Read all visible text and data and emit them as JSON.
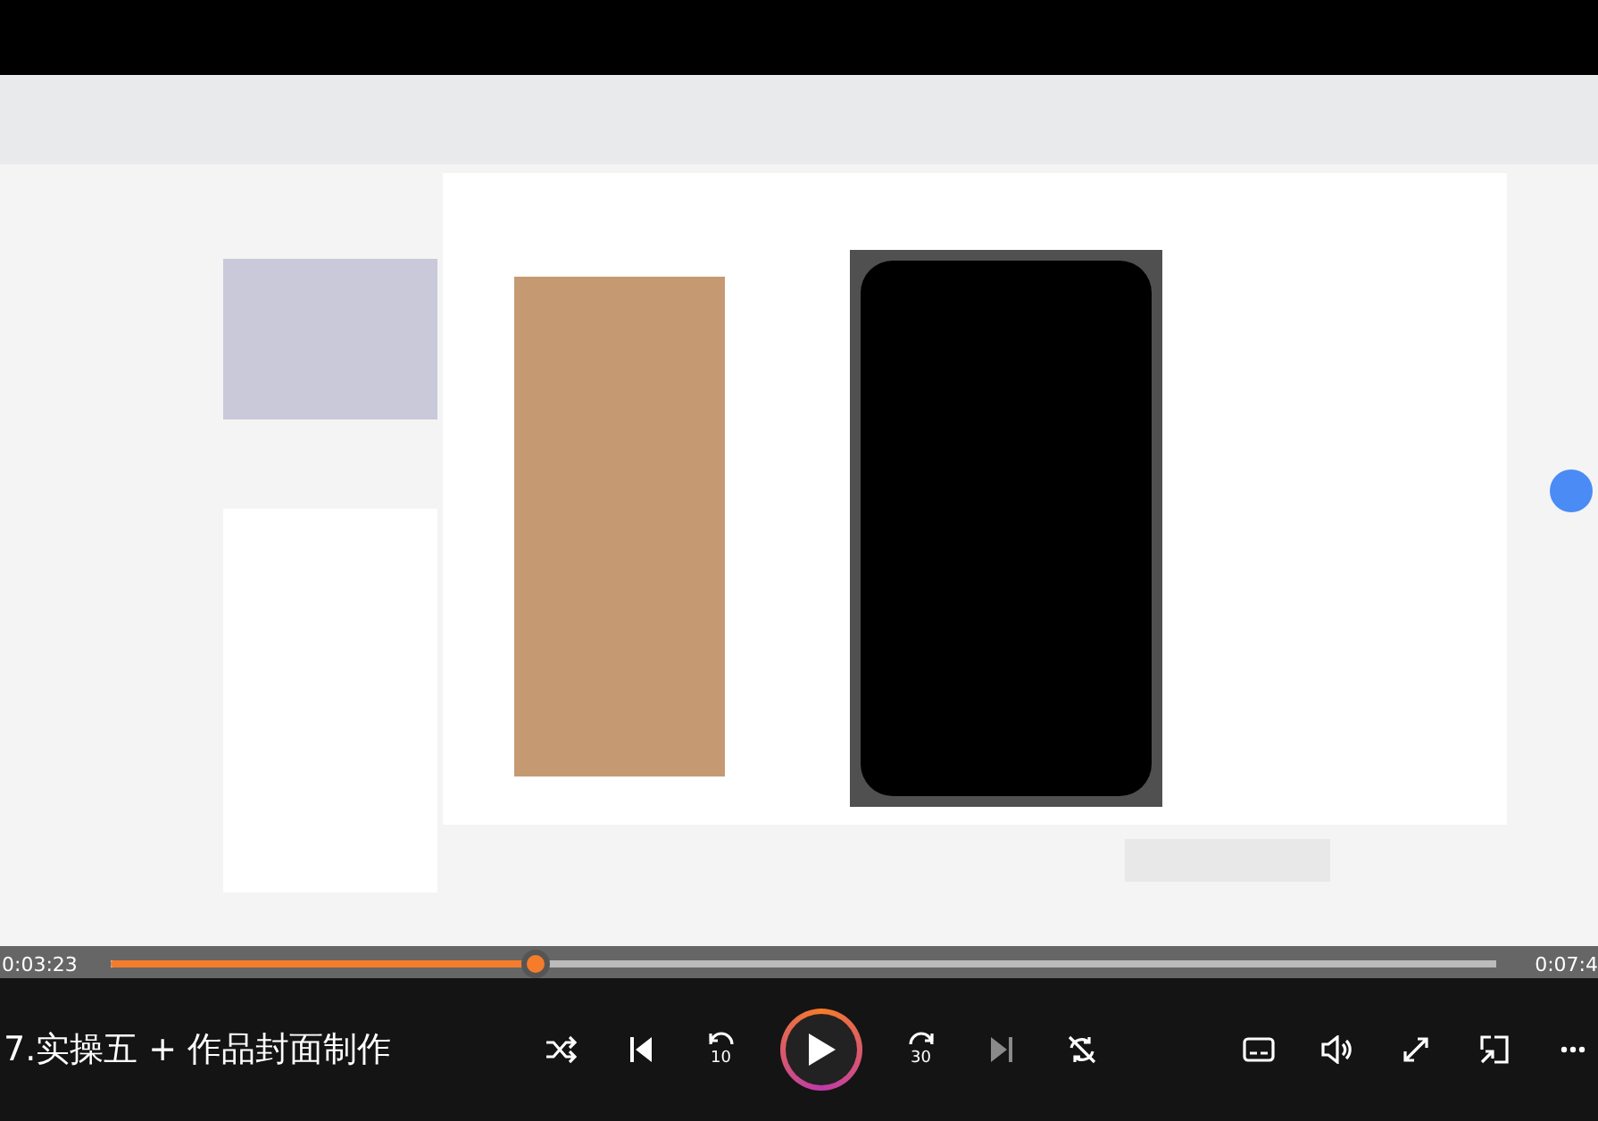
{
  "player": {
    "current_time": "0:03:23",
    "total_time": "0:07:4",
    "level": 0.307,
    "title": "7.实操五 + 作品封面制作",
    "controls": [
      {
        "kind": "shuffle"
      },
      {
        "kind": "previous"
      },
      {
        "kind": "rewind",
        "label": "10"
      },
      {
        "kind": "play"
      },
      {
        "kind": "forward",
        "label": "30"
      },
      {
        "kind": "next",
        "disabled": true
      },
      {
        "kind": "loop"
      }
    ],
    "right_controls": [
      {
        "kind": "subtitles"
      },
      {
        "kind": "volume"
      },
      {
        "kind": "fullscreen"
      },
      {
        "kind": "mini"
      },
      {
        "kind": "more"
      }
    ]
  }
}
